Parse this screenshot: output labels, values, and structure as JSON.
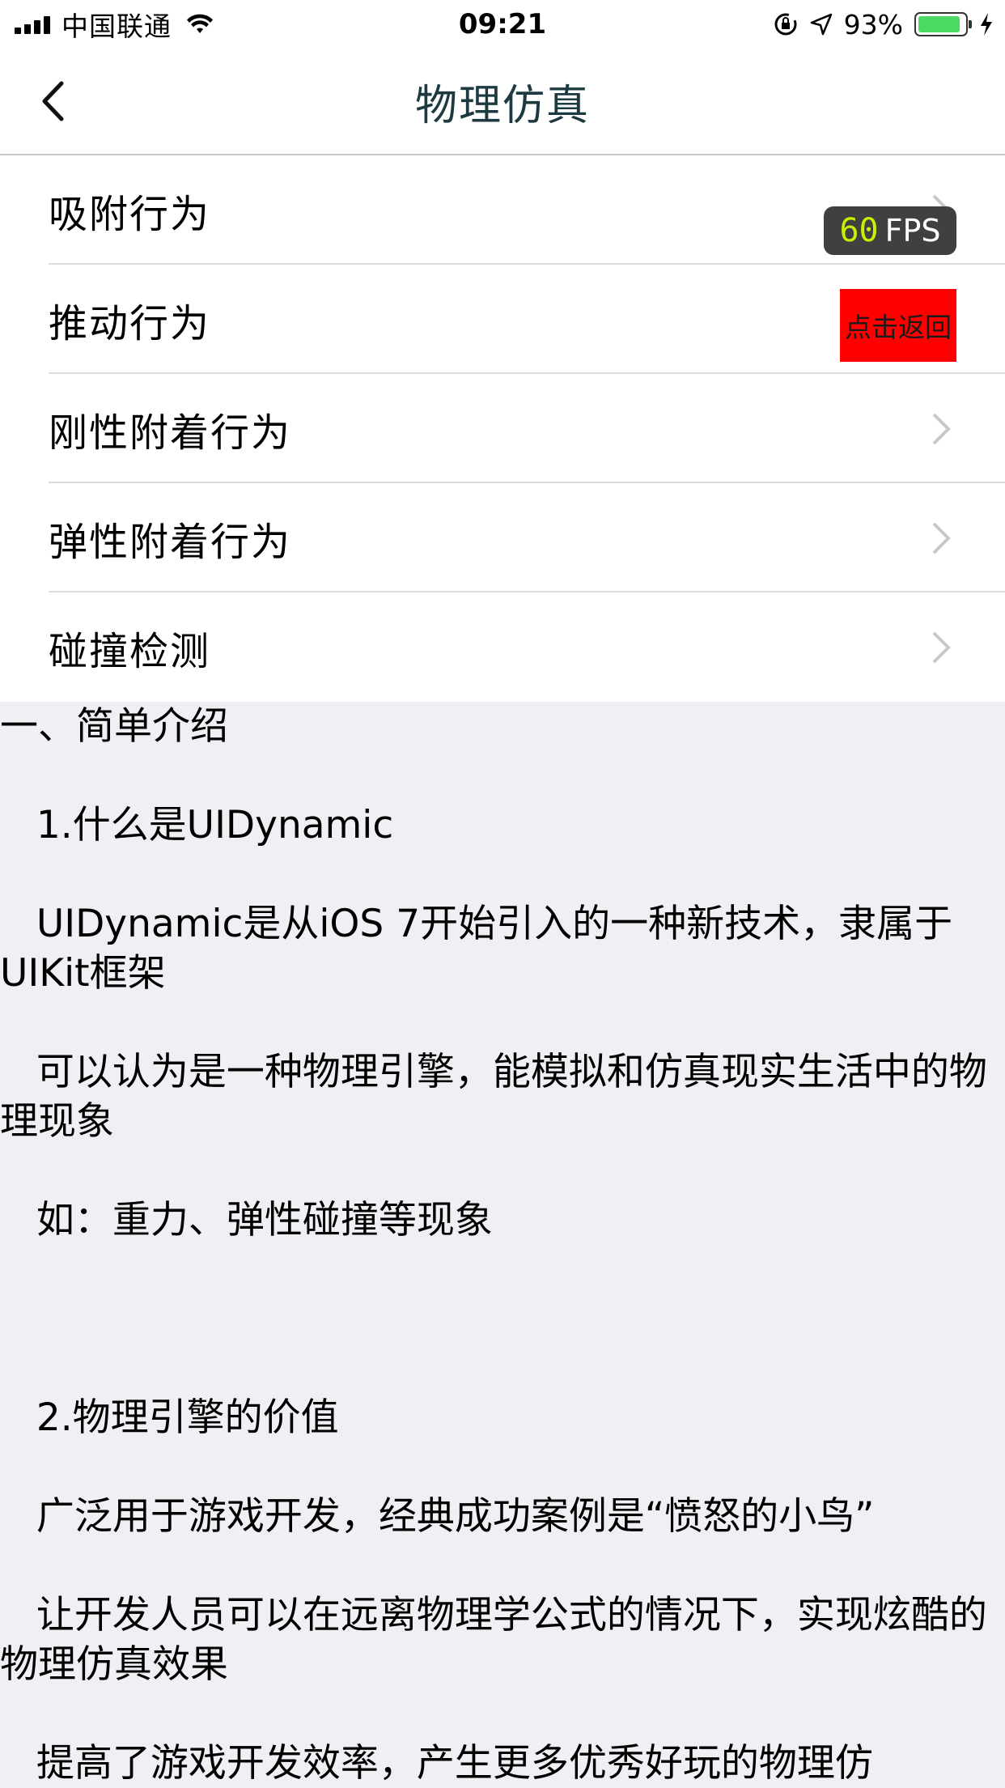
{
  "status_bar": {
    "carrier": "中国联通",
    "time": "09:21",
    "battery_percent": "93%",
    "battery_level": 0.93,
    "icons": [
      "signal-icon",
      "wifi-icon",
      "orientation-lock-icon",
      "location-icon",
      "battery-icon",
      "charging-icon"
    ]
  },
  "nav": {
    "title": "物理仿真",
    "back_icon": "chevron-left-icon",
    "title_color": "#1c3a3f"
  },
  "list": {
    "items": [
      {
        "label": "吸附行为"
      },
      {
        "label": "推动行为"
      },
      {
        "label": "刚性附着行为"
      },
      {
        "label": "弹性附着行为"
      },
      {
        "label": "碰撞检测"
      }
    ],
    "chevron_icon": "chevron-right-icon"
  },
  "overlay": {
    "fps_value": "60",
    "fps_label": "FPS",
    "back_button_label": "点击返回",
    "back_button_color": "#ff0000"
  },
  "article": {
    "lines": [
      "一、简单介绍",
      "   1.什么是UIDynamic",
      "   UIDynamic是从iOS 7开始引入的一种新技术，隶属于UIKit框架",
      "   可以认为是一种物理引擎，能模拟和仿真现实生活中的物理现象",
      "   如：重力、弹性碰撞等现象",
      "",
      "   2.物理引擎的价值",
      "   广泛用于游戏开发，经典成功案例是“愤怒的小鸟”",
      "   让开发人员可以在远离物理学公式的情况下，实现炫酷的物理仿真效果",
      "   提高了游戏开发效率，产生更多优秀好玩的物理仿"
    ]
  }
}
